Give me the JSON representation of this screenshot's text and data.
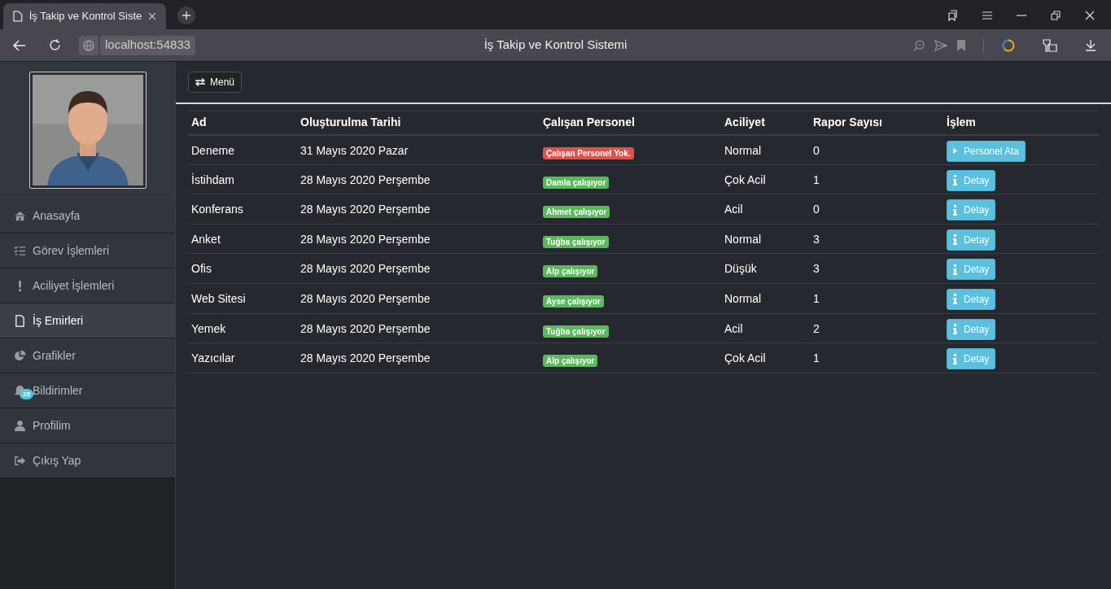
{
  "browser": {
    "tab_title": "İş Takip ve Kontrol Siste",
    "address": "localhost:54833",
    "page_title": "İş Takip ve Kontrol Sistemi"
  },
  "sidebar": {
    "items": [
      {
        "label": "Anasayfa",
        "selected": false
      },
      {
        "label": "Görev İşlemleri",
        "selected": false
      },
      {
        "label": "Aciliyet İşlemleri",
        "selected": false
      },
      {
        "label": "İş Emirleri",
        "selected": true
      },
      {
        "label": "Grafikler",
        "selected": false
      },
      {
        "label": "Bildirimler",
        "selected": false,
        "badge": "25"
      },
      {
        "label": "Profilim",
        "selected": false
      },
      {
        "label": "Çıkış Yap",
        "selected": false
      }
    ]
  },
  "menu_button": "Menü",
  "table": {
    "columns": [
      "Ad",
      "Oluşturulma Tarihi",
      "Çalışan Personel",
      "Aciliyet",
      "Rapor Sayısı",
      "İşlem"
    ],
    "rows": [
      {
        "name": "Deneme",
        "date": "31 Mayıs 2020 Pazar",
        "personnel": {
          "label": "Çalışan Personel Yok.",
          "color": "#d9534f"
        },
        "urgency": "Normal",
        "reports": "0",
        "action": {
          "kind": "assign",
          "label": "Personel Ata"
        }
      },
      {
        "name": "İstihdam",
        "date": "28 Mayıs 2020 Perşembe",
        "personnel": {
          "label": "Damla çalışıyor",
          "color": "#5cb85c"
        },
        "urgency": "Çok Acil",
        "reports": "1",
        "action": {
          "kind": "detail",
          "label": "Detay"
        }
      },
      {
        "name": "Konferans",
        "date": "28 Mayıs 2020 Perşembe",
        "personnel": {
          "label": "Ahmet çalışıyor",
          "color": "#5cb85c"
        },
        "urgency": "Acil",
        "reports": "0",
        "action": {
          "kind": "detail",
          "label": "Detay"
        }
      },
      {
        "name": "Anket",
        "date": "28 Mayıs 2020 Perşembe",
        "personnel": {
          "label": "Tuğba çalışıyor",
          "color": "#5cb85c"
        },
        "urgency": "Normal",
        "reports": "3",
        "action": {
          "kind": "detail",
          "label": "Detay"
        }
      },
      {
        "name": "Ofis",
        "date": "28 Mayıs 2020 Perşembe",
        "personnel": {
          "label": "Alp çalışıyor",
          "color": "#5cb85c"
        },
        "urgency": "Düşük",
        "reports": "3",
        "action": {
          "kind": "detail",
          "label": "Detay"
        }
      },
      {
        "name": "Web Sitesi",
        "date": "28 Mayıs 2020 Perşembe",
        "personnel": {
          "label": "Ayse çalışıyor",
          "color": "#5cb85c"
        },
        "urgency": "Normal",
        "reports": "1",
        "action": {
          "kind": "detail",
          "label": "Detay"
        }
      },
      {
        "name": "Yemek",
        "date": "28 Mayıs 2020 Perşembe",
        "personnel": {
          "label": "Tuğba çalışıyor",
          "color": "#5cb85c"
        },
        "urgency": "Acil",
        "reports": "2",
        "action": {
          "kind": "detail",
          "label": "Detay"
        }
      },
      {
        "name": "Yazıcılar",
        "date": "28 Mayıs 2020 Perşembe",
        "personnel": {
          "label": "Alp çalışıyor",
          "color": "#5cb85c"
        },
        "urgency": "Çok Acil",
        "reports": "1",
        "action": {
          "kind": "detail",
          "label": "Detay"
        }
      }
    ]
  }
}
